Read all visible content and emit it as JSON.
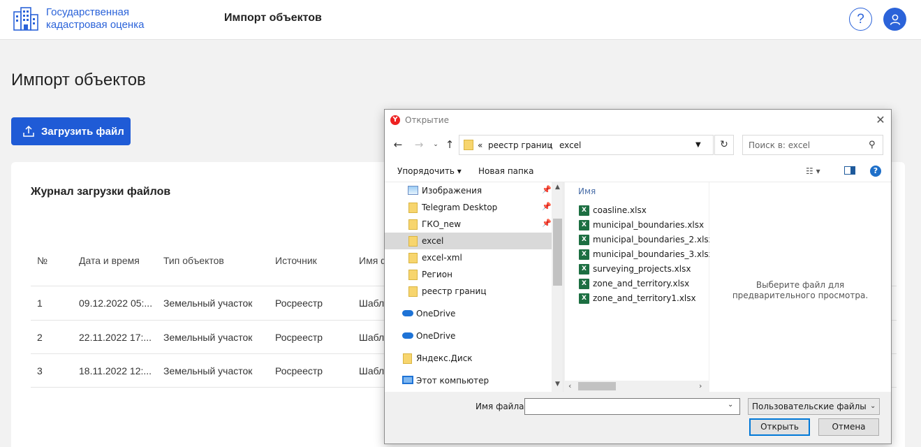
{
  "app": {
    "brand_line1": "Государственная",
    "brand_line2": "кадастровая оценка",
    "header_title": "Импорт объектов",
    "help_symbol": "?",
    "accent_color": "#2b63d9"
  },
  "page": {
    "title": "Импорт объектов",
    "upload_button": "Загрузить файл"
  },
  "journal": {
    "title": "Журнал загрузки файлов",
    "columns": [
      "№",
      "Дата и время",
      "Тип объектов",
      "Источник",
      "Имя ф"
    ],
    "rows": [
      [
        "1",
        "09.12.2022 05:...",
        "Земельный участок",
        "Росреестр",
        "Шабл"
      ],
      [
        "2",
        "22.11.2022 17:...",
        "Земельный участок",
        "Росреестр",
        "Шабл"
      ],
      [
        "3",
        "18.11.2022 12:...",
        "Земельный участок",
        "Росреестр",
        "Шабл"
      ]
    ]
  },
  "dialog": {
    "app_icon": "Y",
    "title": "Открытие",
    "close": "✕",
    "breadcrumb": {
      "overflow": "«",
      "parent": "реестр границ",
      "separator": "›",
      "current": "excel"
    },
    "search_placeholder": "Поиск в: excel",
    "toolbar": {
      "organize": "Упорядочить ▾",
      "new_folder": "Новая папка",
      "help": "?"
    },
    "nav_items": [
      {
        "label": "Изображения",
        "icon": "pictures-icon",
        "pinned": true
      },
      {
        "label": "Telegram Desktop",
        "icon": "folder-icon",
        "pinned": true
      },
      {
        "label": "ГКО_new",
        "icon": "folder-icon",
        "pinned": true
      },
      {
        "label": "excel",
        "icon": "folder-icon",
        "selected": true
      },
      {
        "label": "excel-xml",
        "icon": "folder-icon"
      },
      {
        "label": "Регион",
        "icon": "folder-icon"
      },
      {
        "label": "реестр границ",
        "icon": "folder-icon"
      },
      {
        "label": "OneDrive",
        "icon": "onedrive-icon"
      },
      {
        "label": "OneDrive",
        "icon": "onedrive-icon"
      },
      {
        "label": "Яндекс.Диск",
        "icon": "folder-icon"
      },
      {
        "label": "Этот компьютер",
        "icon": "computer-icon"
      }
    ],
    "column_name": "Имя",
    "files": [
      "coasline.xlsx",
      "municipal_boundaries.xlsx",
      "municipal_boundaries_2.xlsx",
      "municipal_boundaries_3.xlsx",
      "surveying_projects.xlsx",
      "zone_and_territory.xlsx",
      "zone_and_territory1.xlsx"
    ],
    "preview_text": "Выберите файл для предварительного просмотра.",
    "filename_label": "Имя файла:",
    "filename_value": "",
    "filter": "Пользовательские файлы (*.c",
    "open_button": "Открыть",
    "cancel_button": "Отмена"
  }
}
